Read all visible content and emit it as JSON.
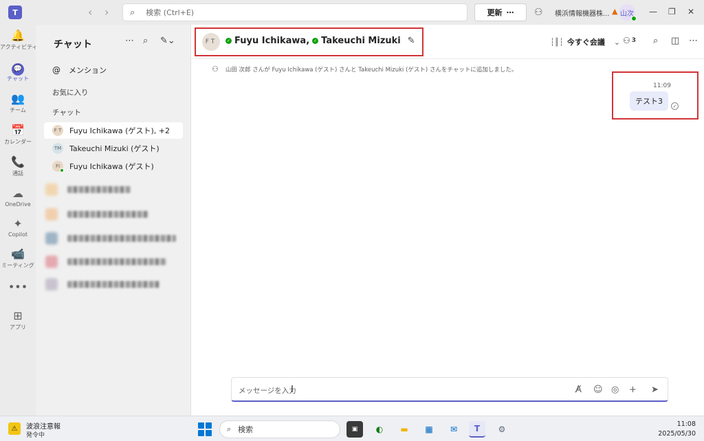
{
  "titlebar": {
    "search_placeholder": "検索 (Ctrl+E)",
    "update_label": "更新",
    "update_more": "⋯",
    "org_name": "横浜情報機器株...",
    "user_initial": "山次"
  },
  "rail": [
    {
      "icon": "bell-icon",
      "glyph": "🔔",
      "label": "アクティビティ"
    },
    {
      "icon": "chat-icon",
      "glyph": "💬",
      "label": "チャット",
      "active": true
    },
    {
      "icon": "teams-icon",
      "glyph": "👥",
      "label": "チーム"
    },
    {
      "icon": "calendar-icon",
      "glyph": "📅",
      "label": "カレンダー"
    },
    {
      "icon": "phone-icon",
      "glyph": "📞",
      "label": "通話"
    },
    {
      "icon": "cloud-icon",
      "glyph": "☁",
      "label": "OneDrive"
    },
    {
      "icon": "copilot-icon",
      "glyph": "✦",
      "label": "Copilot"
    },
    {
      "icon": "video-icon",
      "glyph": "📹",
      "label": "ミーティング"
    },
    {
      "icon": "more-icon",
      "glyph": "•••",
      "label": ""
    },
    {
      "icon": "add-app-icon",
      "glyph": "⊞",
      "label": "アプリ"
    }
  ],
  "chatlist": {
    "title": "チャット",
    "mention": "メンション",
    "favorites": "お気に入り",
    "chats_section": "チャット",
    "chats": [
      {
        "initials": "F T",
        "name": "Fuyu Ichikawa (ゲスト), +2"
      },
      {
        "initials": "TM",
        "name": "Takeuchi Mizuki (ゲスト)"
      },
      {
        "initials": "FI",
        "name": "Fuyu Ichikawa (ゲスト)"
      }
    ]
  },
  "header": {
    "initials": "FT",
    "member1": "Fuyu Ichikawa",
    "separator": ",",
    "member2": "Takeuchi Mizuki",
    "meet_now": "今すぐ会議",
    "participants_count": "3"
  },
  "conversation": {
    "system_message": "山田 次郎 さんが Fuyu Ichikawa (ゲスト) さんと Takeuchi Mizuki (ゲスト) さんをチャットに追加しました。",
    "message_time": "11:09",
    "message_text": "テスト3"
  },
  "composer": {
    "placeholder": "メッセージを入力"
  },
  "taskbar": {
    "weather_title": "波浪注意報",
    "weather_sub": "発令中",
    "search_label": "検索",
    "time": "11:08",
    "date": "2025/05/30"
  }
}
